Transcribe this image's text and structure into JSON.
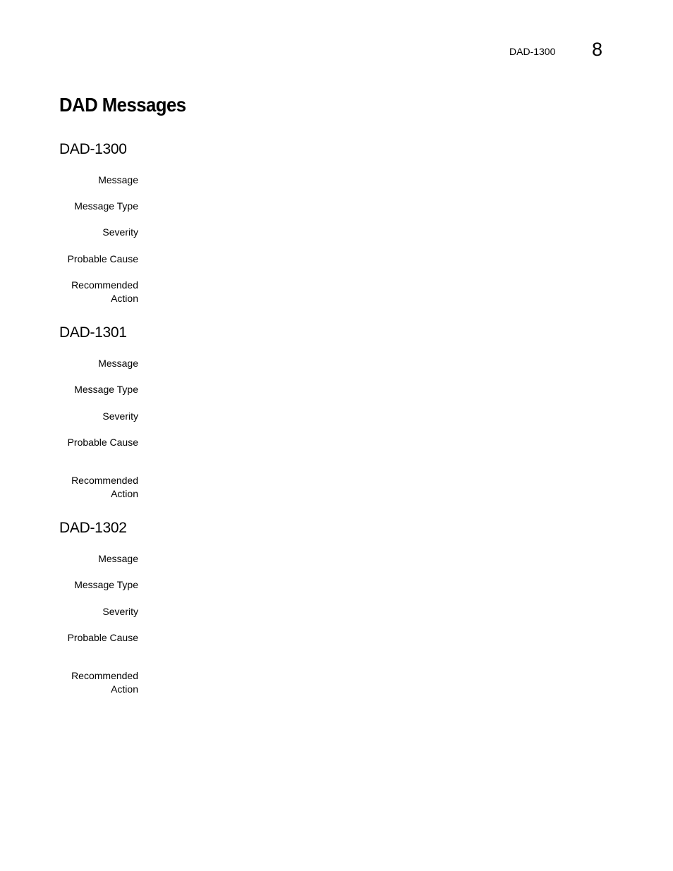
{
  "header": {
    "code": "DAD-1300",
    "chapter": "8"
  },
  "page_title": "DAD Messages",
  "labels": {
    "message": "Message",
    "message_type": "Message Type",
    "severity": "Severity",
    "probable_cause": "Probable Cause",
    "recommended": "Recommended",
    "action": "Action"
  },
  "sections": [
    {
      "id": "DAD-1300"
    },
    {
      "id": "DAD-1301"
    },
    {
      "id": "DAD-1302"
    }
  ]
}
